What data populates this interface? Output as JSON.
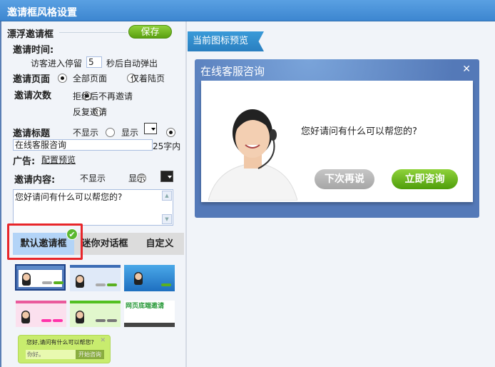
{
  "window": {
    "title": "邀请框风格设置"
  },
  "form": {
    "section_title": "漂浮邀请框",
    "save_label": "保存",
    "invite_time_label": "邀请时间:",
    "stay_prefix": "访客进入停留",
    "stay_seconds": "5",
    "stay_suffix": "秒后自动弹出",
    "invite_page_label": "邀请页面",
    "page_options": [
      "全部页面",
      "仅着陆页"
    ],
    "invite_count_label": "邀请次数",
    "count_options": [
      "拒绝后不再邀请",
      "反复邀请"
    ],
    "invite_title_label": "邀请标题",
    "title_options": [
      "不显示",
      "显示"
    ],
    "title_value": "在线客服咨询",
    "title_limit": "25字内",
    "ad_label": "广告:",
    "ad_link": "配置预览",
    "content_label": "邀请内容:",
    "content_options": [
      "不显示",
      "显示"
    ],
    "content_value": "您好请问有什么可以帮您的?"
  },
  "style_tabs": [
    "默认邀请框",
    "迷你对话框",
    "自定义"
  ],
  "thumbnails": {
    "bottom_banner_text": "网页底端邀请"
  },
  "mini_bubble": {
    "text": "您好,请问有什么可以帮您?",
    "input_value": "你好。",
    "button": "开始咨询"
  },
  "preview": {
    "ribbon": "当前图标预览",
    "dialog_title": "在线客服咨询",
    "message": "您好请问有什么可以帮您的?",
    "later_button": "下次再说",
    "consult_button": "立即咨询"
  }
}
